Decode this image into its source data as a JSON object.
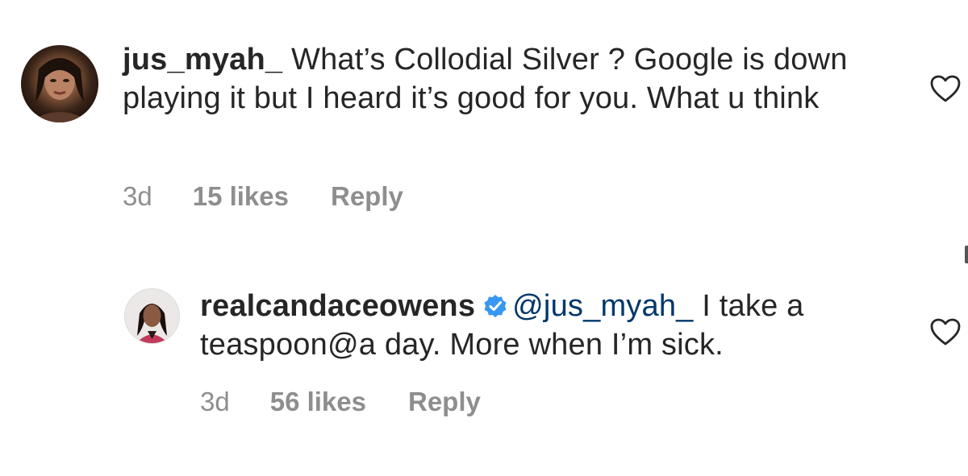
{
  "comments": [
    {
      "username": "jus_myah_",
      "text": "What’s Collodial Silver ? Google is down playing it but I heard it’s good for you. What u think",
      "time": "3d",
      "likes": "15 likes",
      "reply_label": "Reply",
      "avatar_icon": "user-avatar-photo",
      "like_icon": "heart-outline-icon"
    },
    {
      "username": "realcandaceowens",
      "verified_icon": "verified-badge-icon",
      "mention": "@jus_myah_",
      "text": "I take a teaspoon@a day. More when I’m sick.",
      "time": "3d",
      "likes": "56 likes",
      "reply_label": "Reply",
      "avatar_icon": "user-avatar-photo",
      "like_icon": "heart-outline-icon"
    }
  ],
  "colors": {
    "username": "#262626",
    "meta": "#8e8e8e",
    "mention": "#00376b",
    "verified": "#3897f0"
  }
}
